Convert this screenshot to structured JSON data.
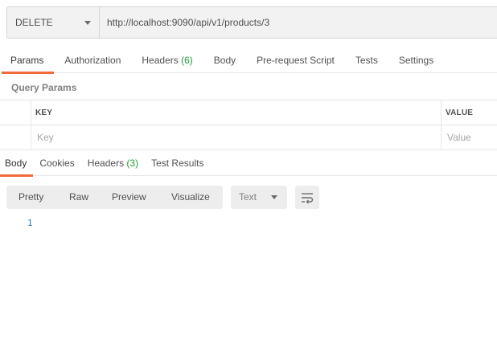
{
  "request": {
    "method": "DELETE",
    "url": "http://localhost:9090/api/v1/products/3"
  },
  "request_tabs": [
    {
      "label": "Params",
      "count": "",
      "active": true
    },
    {
      "label": "Authorization",
      "count": "",
      "active": false
    },
    {
      "label": "Headers",
      "count": "(6)",
      "active": false
    },
    {
      "label": "Body",
      "count": "",
      "active": false
    },
    {
      "label": "Pre-request Script",
      "count": "",
      "active": false
    },
    {
      "label": "Tests",
      "count": "",
      "active": false
    },
    {
      "label": "Settings",
      "count": "",
      "active": false
    }
  ],
  "query_params": {
    "title": "Query Params",
    "columns": [
      "KEY",
      "VALUE"
    ],
    "placeholders": {
      "key": "Key",
      "value": "Value"
    }
  },
  "response_tabs": [
    {
      "label": "Body",
      "count": "",
      "active": true
    },
    {
      "label": "Cookies",
      "count": "",
      "active": false
    },
    {
      "label": "Headers",
      "count": "(3)",
      "active": false
    },
    {
      "label": "Test Results",
      "count": "",
      "active": false
    }
  ],
  "format_buttons": [
    "Pretty",
    "Raw",
    "Preview",
    "Visualize"
  ],
  "language_select": "Text",
  "icons": {
    "method_caret": "chevron-down-icon",
    "wrap": "wrap-lines-icon"
  },
  "response_body": {
    "line_numbers": [
      "1"
    ]
  },
  "colors": {
    "accent": "#f26b3a",
    "count": "#26a03b",
    "line_number": "#2a7ab0"
  }
}
